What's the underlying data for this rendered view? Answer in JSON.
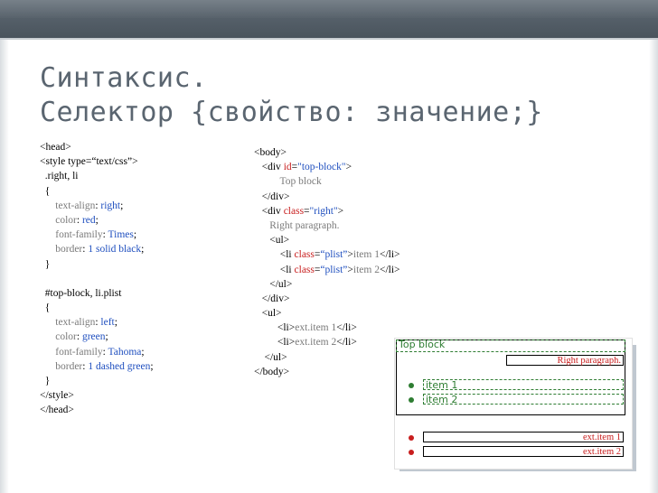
{
  "slide": {
    "title_line1": "Синтаксис.",
    "title_line2": "Селектор {свойство: значение;}"
  },
  "colors": {
    "topbar": "#4a545d",
    "title": "#5a6570",
    "keyword_blue": "#1f4fbf",
    "value_red": "#c81e1e",
    "green": "#2e7d32"
  },
  "left_code": {
    "l1": "<head>",
    "l2": "<style type=“text/css”>",
    "l3": "  .right, li",
    "l4": "  {",
    "l5_prop": "text-align",
    "l5_val": "right",
    "l6_prop": "color",
    "l6_val": "red",
    "l7_prop": "font-family",
    "l7_val": "Times",
    "l8_prop": "border",
    "l8_val": "1 solid black",
    "l9": "  }",
    "l10": "  #top-block, li.plist",
    "l11": "  {",
    "l12_prop": "text-align",
    "l12_val": "left",
    "l13_prop": "color",
    "l13_val": "green",
    "l14_prop": "font-family",
    "l14_val": "Tahoma",
    "l15_prop": "border",
    "l15_val": "1 dashed green",
    "l16": "  }",
    "l17": "</style>",
    "l18": "</head>"
  },
  "right_code": {
    "body_open": "<body>",
    "div_open_pre": "<div ",
    "div_id_attr": "id",
    "div_id_val": "\"top-block\"",
    "div_close_bracket": ">",
    "top_block_text": "Top block",
    "div_close": "</div>",
    "div2_open_pre": "<div ",
    "div2_class_attr": "class",
    "div2_class_val": "\"right\"",
    "div2_close_bracket": ">",
    "right_para_text": "Right paragraph.",
    "ul_open": "<ul>",
    "li1_pre": "<li ",
    "li1_class_attr": "class",
    "li1_class_val": "“plist”",
    "li1_gt": ">",
    "li1_text": "item 1",
    "li1_close": "</li>",
    "li2_pre": "<li ",
    "li2_class_attr": "class",
    "li2_class_val": "“plist”",
    "li2_gt": ">",
    "li2_text": "item 2",
    "li2_close": "</li>",
    "ul_close": "</ul>",
    "div2_close": "</div>",
    "ul2_open": "<ul>",
    "ext1_open": "<li>",
    "ext1_text": "ext.item 1",
    "ext1_close": "</li>",
    "ext2_open": "<li>",
    "ext2_text": "ext.item 2",
    "ext2_close": "</li>",
    "ul2_close": "</ul>",
    "body_close": "</body>"
  },
  "demo": {
    "top_block": "Top block",
    "right_paragraph": "Right paragraph.",
    "item1": "item 1",
    "item2": "item 2",
    "ext1": "ext.item 1",
    "ext2": "ext.item 2"
  }
}
